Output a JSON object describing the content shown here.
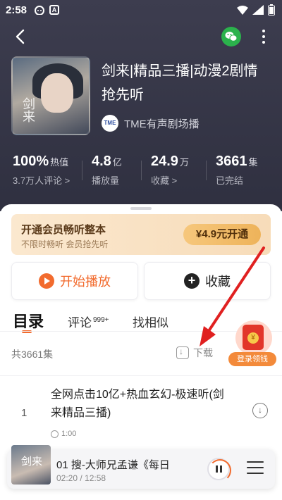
{
  "status_bar": {
    "time": "2:58",
    "notif_icon_a": "A"
  },
  "nav": {
    "back": "back-arrow-icon",
    "share": "wechat-icon",
    "more": "more-icon"
  },
  "album": {
    "cover_text": "剑来",
    "title": "剑来|精品三播|动漫2剧情抢先听",
    "publisher": "TME有声剧场播",
    "publisher_logo_text": "TME"
  },
  "stats": {
    "heat": {
      "value": "100%",
      "unit": "热值",
      "sub": "3.7万人评论 >"
    },
    "plays": {
      "value": "4.8",
      "unit": "亿",
      "sub": "播放量"
    },
    "favorites": {
      "value": "24.9",
      "unit": "万",
      "sub": "收藏 >"
    },
    "episodes": {
      "value": "3661",
      "unit": "集",
      "sub": "已完结"
    }
  },
  "vip": {
    "title": "开通会员畅听整本",
    "subtitle": "不限时畅听 会员抢先听",
    "button": "¥4.9元开通"
  },
  "actions": {
    "play": "开始播放",
    "favorite": "收藏"
  },
  "tabs": {
    "catalog": "目录",
    "comments": "评论",
    "comments_count": "999+",
    "similar": "找相似"
  },
  "list": {
    "count": "共3661集",
    "download": "下载"
  },
  "promo": {
    "label": "登录领钱",
    "coin": "¥"
  },
  "episodes": [
    {
      "index": "1",
      "title": "全网点击10亿+热血玄幻-极速听(剑来精品三播)",
      "duration": "1:00"
    }
  ],
  "player": {
    "cover_text": "剑来",
    "title": "01 搜-大师兄孟谦《每日",
    "time": "02:20 / 12:58"
  },
  "colors": {
    "accent": "#f26b2e",
    "header_bg": "#34354a",
    "vip_bg": "#f7dcb9",
    "arrow": "#e02020"
  }
}
